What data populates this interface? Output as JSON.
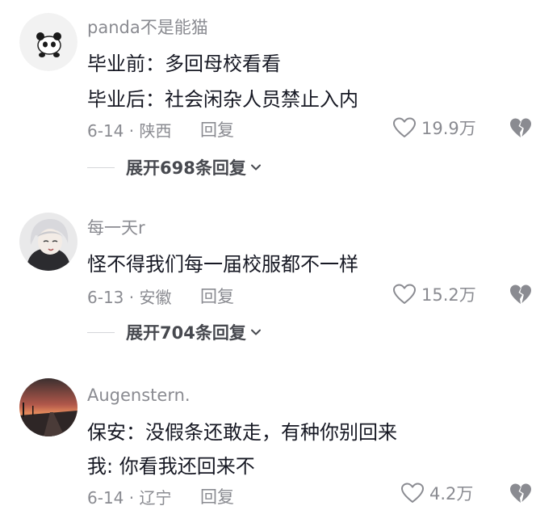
{
  "comments": [
    {
      "avatar_icon": "panda-avatar-icon",
      "username": "panda不是能猫",
      "lines": [
        "毕业前：多回母校看看",
        "毕业后：社会闲杂人员禁止入内"
      ],
      "date_location": "6-14 · 陕西",
      "reply_label": "回复",
      "likes": "19.9万",
      "expand_label": "展开698条回复"
    },
    {
      "avatar_icon": "anime-character-avatar-icon",
      "username": "每一天r",
      "lines": [
        "怪不得我们每一届校服都不一样"
      ],
      "date_location": "6-13 · 安徽",
      "reply_label": "回复",
      "likes": "15.2万",
      "expand_label": "展开704条回复"
    },
    {
      "avatar_icon": "sunset-road-avatar-icon",
      "username": "Augenstern.",
      "lines": [
        "保安：没假条还敢走，有种你别回来",
        "我: 你看我还回来不"
      ],
      "date_location": "6-14 · 辽宁",
      "reply_label": "回复",
      "likes": "4.2万"
    }
  ],
  "colors": {
    "primary_text": "#161823",
    "secondary_text": "#8a8b91",
    "expand_text": "#47494f"
  }
}
